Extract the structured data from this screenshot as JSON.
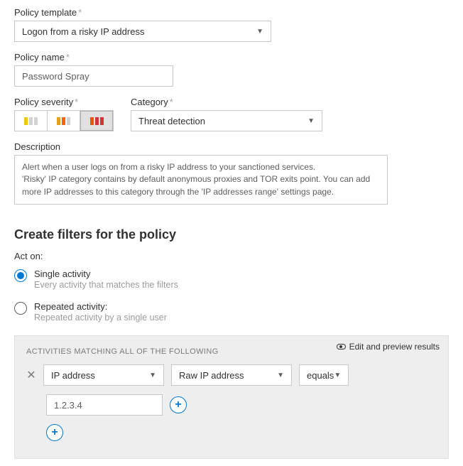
{
  "labels": {
    "policy_template": "Policy template",
    "policy_name": "Policy name",
    "policy_severity": "Policy severity",
    "category": "Category",
    "description": "Description",
    "required_mark": "*"
  },
  "policy_template": {
    "selected": "Logon from a risky IP address"
  },
  "policy_name": {
    "value": "Password Spray"
  },
  "category": {
    "selected": "Threat detection"
  },
  "description": {
    "text": "Alert when a user logs on from a risky IP address to your sanctioned services.\n'Risky' IP category contains by default anonymous proxies and TOR exits point. You can add more IP addresses to this category through the 'IP addresses range' settings page."
  },
  "filters_section": {
    "title": "Create filters for the policy",
    "act_on_label": "Act on:",
    "options": {
      "single": {
        "label": "Single activity",
        "sub": "Every activity that matches the filters",
        "selected": true
      },
      "repeated": {
        "label": "Repeated activity:",
        "sub": "Repeated activity by a single user",
        "selected": false
      }
    },
    "panel_header": "ACTIVITIES MATCHING ALL OF THE FOLLOWING",
    "preview_link": "Edit and preview results",
    "filter": {
      "field": "IP address",
      "subfield": "Raw IP address",
      "operator": "equals",
      "value": "1.2.3.4"
    }
  }
}
